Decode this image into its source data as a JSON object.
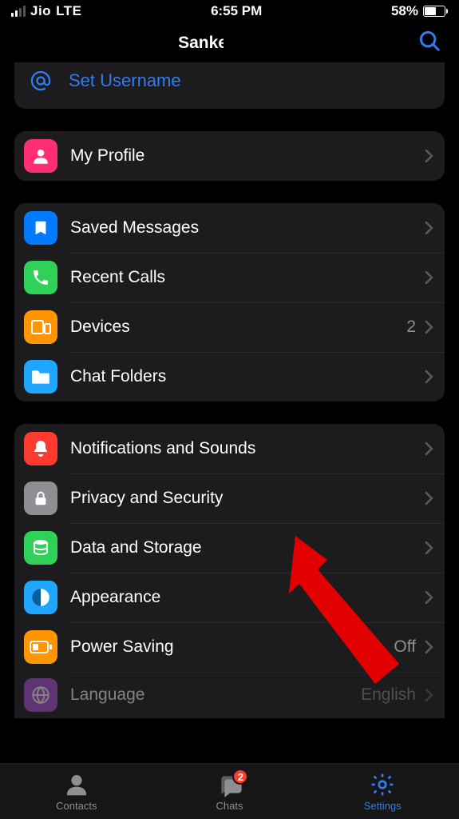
{
  "status": {
    "carrier": "Jio",
    "network": "LTE",
    "time": "6:55 PM",
    "battery_pct": "58%",
    "battery_fill": 58
  },
  "header": {
    "title": "Sanket"
  },
  "username_row": {
    "label": "Set Username"
  },
  "section_profile": [
    {
      "label": "My Profile",
      "icon": "profile-icon",
      "color": "c-pink"
    }
  ],
  "section_general": [
    {
      "label": "Saved Messages",
      "icon": "bookmark-icon",
      "color": "c-blue"
    },
    {
      "label": "Recent Calls",
      "icon": "phone-icon",
      "color": "c-green"
    },
    {
      "label": "Devices",
      "icon": "devices-icon",
      "color": "c-orange",
      "value": "2"
    },
    {
      "label": "Chat Folders",
      "icon": "folder-icon",
      "color": "c-folder"
    }
  ],
  "section_settings": [
    {
      "label": "Notifications and Sounds",
      "icon": "bell-icon",
      "color": "c-red"
    },
    {
      "label": "Privacy and Security",
      "icon": "lock-icon",
      "color": "c-gray"
    },
    {
      "label": "Data and Storage",
      "icon": "database-icon",
      "color": "c-dgreen"
    },
    {
      "label": "Appearance",
      "icon": "appearance-icon",
      "color": "c-dblue"
    },
    {
      "label": "Power Saving",
      "icon": "battery-icon",
      "color": "c-orange",
      "value": "Off"
    },
    {
      "label": "Language",
      "icon": "globe-icon",
      "color": "c-purple",
      "value": "English"
    }
  ],
  "tabs": {
    "contacts": "Contacts",
    "chats": "Chats",
    "chats_badge": "2",
    "settings": "Settings"
  }
}
